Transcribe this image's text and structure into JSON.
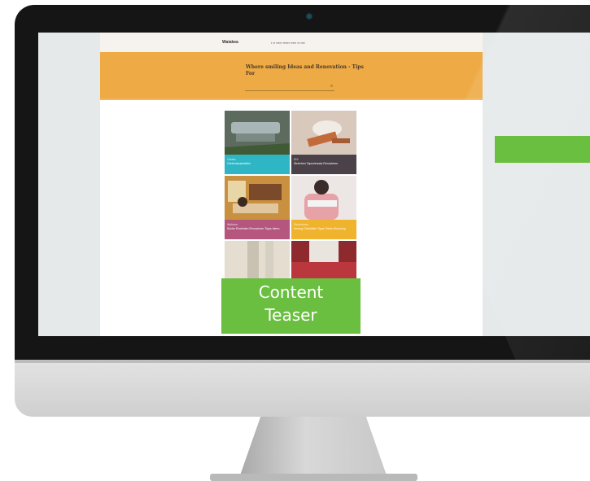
{
  "site": {
    "logo": "Waiakea",
    "nav": [
      "▪ ▪▪ ▪▪▪▪▪ ▪▪▪▪▪▪ ▪▪▪▪▪ ▪▪ ▪▪▪▪"
    ],
    "hero_title": "Where smiling Ideas and Renovation - Tips For",
    "tiles": [
      {
        "category": "Garten",
        "title": "Gartenbauarbeiten",
        "caption_color": "#2eb6c4",
        "photo_color": "#5d6a5e"
      },
      {
        "category": "DIY",
        "title": "Streichen Tapeziersatz Renovieren",
        "caption_color": "#4a4248",
        "photo_color": "#d8c9bc"
      },
      {
        "category": "Wohnen",
        "title": "Küche Einrichten Renovieren Tipps Ideen",
        "caption_color": "#b5567e",
        "photo_color": "#c99040"
      },
      {
        "category": "Renovieren",
        "title": "Umzug Checkliste Tipps Tricks Wohnung",
        "caption_color": "#f0b32e",
        "photo_color": "#e7b7b0"
      },
      {
        "category": "",
        "title": "",
        "caption_color": "#e4ddd0",
        "photo_color": "#d3cfc6"
      },
      {
        "category": "",
        "title": "",
        "caption_color": "#8e2a2e",
        "photo_color": "#b9373d"
      }
    ]
  },
  "overlay": {
    "line1": "Content",
    "line2": "Teaser"
  },
  "colors": {
    "accent_green": "#6abf40",
    "hero_orange": "#eeaa44"
  }
}
